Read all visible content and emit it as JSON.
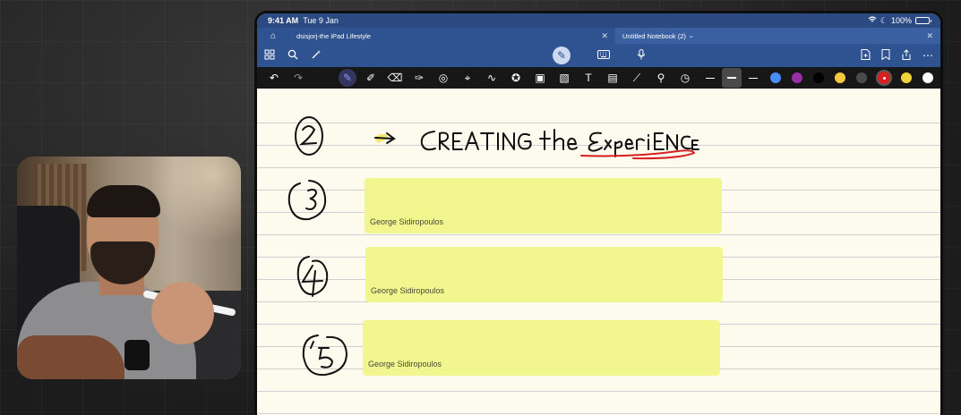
{
  "status": {
    "time": "9:41 AM",
    "date": "Tue 9 Jan",
    "battery": "100%",
    "battery_level": 1.0
  },
  "tabs": [
    {
      "label": "dsisjorj-the iPad Lifestyle"
    },
    {
      "label": "Untitled Notebook (2)"
    }
  ],
  "navbar": {
    "left_icons": [
      "grid-icon",
      "search-icon",
      "magic-icon"
    ],
    "center_icons": [
      "pen-mode-icon",
      "keyboard-icon",
      "microphone-icon"
    ],
    "right_icons": [
      "add-page-icon",
      "bookmark-icon",
      "share-icon",
      "more-icon"
    ]
  },
  "toolbar": {
    "colors": [
      "#4a8cf5",
      "#9a2ea7",
      "#000000",
      "#f5c842",
      "#4a4a4a",
      "#d61f1f",
      "#f3d33a",
      "#ffffff"
    ],
    "selected_color": "#d61f1f"
  },
  "notes": {
    "author": "George Sidiropoulos",
    "sticky_notes": [
      {
        "author": "George Sidiropoulos"
      },
      {
        "author": "George Sidiropoulos"
      },
      {
        "author": "George Sidiropoulos"
      }
    ]
  }
}
